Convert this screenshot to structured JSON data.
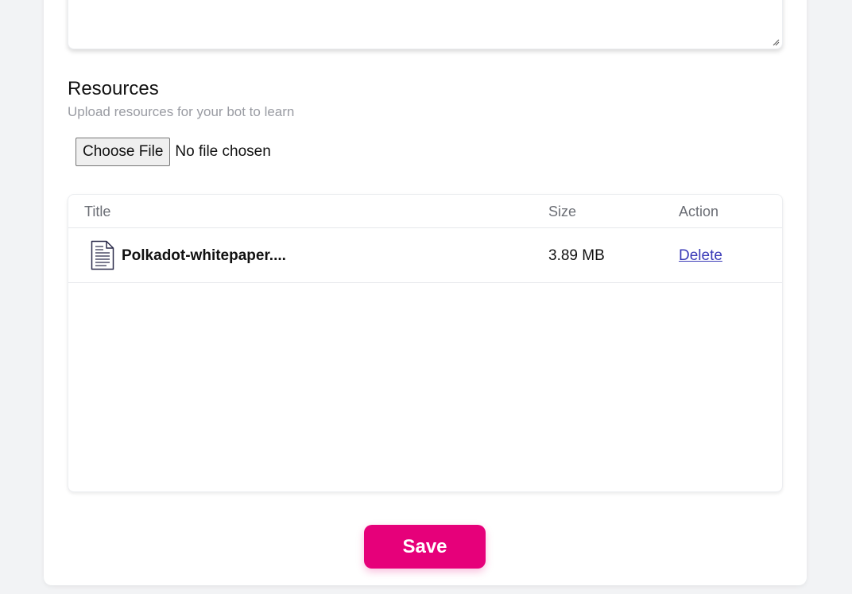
{
  "resources": {
    "title": "Resources",
    "subtitle": "Upload resources for your bot to learn",
    "file_input": {
      "button_label": "Choose File",
      "status": "No file chosen"
    },
    "table": {
      "columns": [
        "Title",
        "Size",
        "Action"
      ],
      "rows": [
        {
          "icon": "document-icon",
          "title": "Polkadot-whitepaper....",
          "size": "3.89 MB",
          "action": "Delete"
        }
      ]
    }
  },
  "save_button_label": "Save",
  "colors": {
    "accent": "#e6007a",
    "link": "#3b3bb8",
    "muted_text": "#9a9ca3",
    "background": "#f2f3f5"
  }
}
